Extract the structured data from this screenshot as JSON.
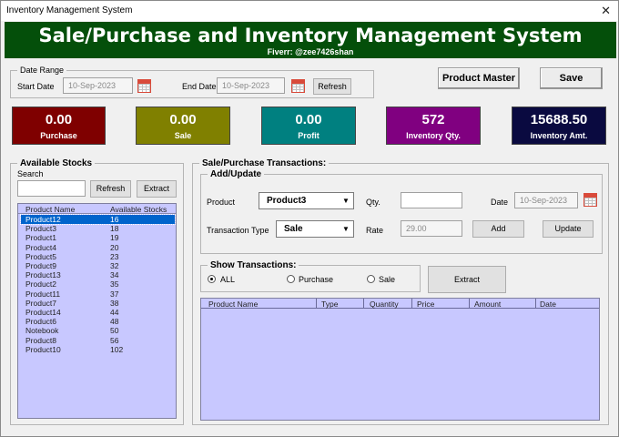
{
  "window": {
    "title": "Inventory Management System",
    "close_glyph": "✕"
  },
  "banner": {
    "title": "Sale/Purchase and Inventory Management System",
    "subtitle": "Fiverr: @zee7426shan",
    "color": "#044f0a"
  },
  "date_range": {
    "legend": "Date Range",
    "start_label": "Start Date",
    "start_value": "10-Sep-2023",
    "end_label": "End Date",
    "end_value": "10-Sep-2023",
    "refresh_label": "Refresh"
  },
  "toolbar": {
    "product_master_label": "Product Master",
    "save_label": "Save"
  },
  "cards": [
    {
      "value": "0.00",
      "caption": "Purchase",
      "color": "#7f0000"
    },
    {
      "value": "0.00",
      "caption": "Sale",
      "color": "#808000"
    },
    {
      "value": "0.00",
      "caption": "Profit",
      "color": "#008080"
    },
    {
      "value": "572",
      "caption": "Inventory Qty.",
      "color": "#800080"
    },
    {
      "value": "15688.50",
      "caption": "Inventory Amt.",
      "color": "#0a0a40"
    }
  ],
  "stocks": {
    "legend": "Available Stocks",
    "search_label": "Search",
    "search_value": "",
    "refresh_label": "Refresh",
    "extract_label": "Extract",
    "columns": [
      "Product Name",
      "Available Stocks"
    ],
    "rows": [
      [
        "Product12",
        "16"
      ],
      [
        "Product3",
        "18"
      ],
      [
        "Product1",
        "19"
      ],
      [
        "Product4",
        "20"
      ],
      [
        "Product5",
        "23"
      ],
      [
        "Product9",
        "32"
      ],
      [
        "Product13",
        "34"
      ],
      [
        "Product2",
        "35"
      ],
      [
        "Product11",
        "37"
      ],
      [
        "Product7",
        "38"
      ],
      [
        "Product14",
        "44"
      ],
      [
        "Product6",
        "48"
      ],
      [
        "Notebook",
        "50"
      ],
      [
        "Product8",
        "56"
      ],
      [
        "Product10",
        "102"
      ]
    ],
    "selected_index": 0
  },
  "transactions": {
    "legend": "Sale/Purchase Transactions:",
    "add_update": {
      "legend": "Add/Update",
      "product_label": "Product",
      "product_value": "Product3",
      "qty_label": "Qty.",
      "qty_value": "",
      "date_label": "Date",
      "date_value": "10-Sep-2023",
      "type_label": "Transaction Type",
      "type_value": "Sale",
      "rate_label": "Rate",
      "rate_value": "29.00",
      "add_label": "Add",
      "update_label": "Update"
    },
    "show": {
      "legend": "Show Transactions:",
      "options": [
        "ALL",
        "Purchase",
        "Sale"
      ],
      "selected": "ALL",
      "extract_label": "Extract"
    },
    "columns": [
      "Product Name",
      "Type",
      "Quantity",
      "Price",
      "Amount",
      "Date"
    ],
    "rows": []
  },
  "icons": {
    "calendar": "calendar-icon",
    "dropdown": "chevron-down-icon",
    "close": "close-icon"
  }
}
